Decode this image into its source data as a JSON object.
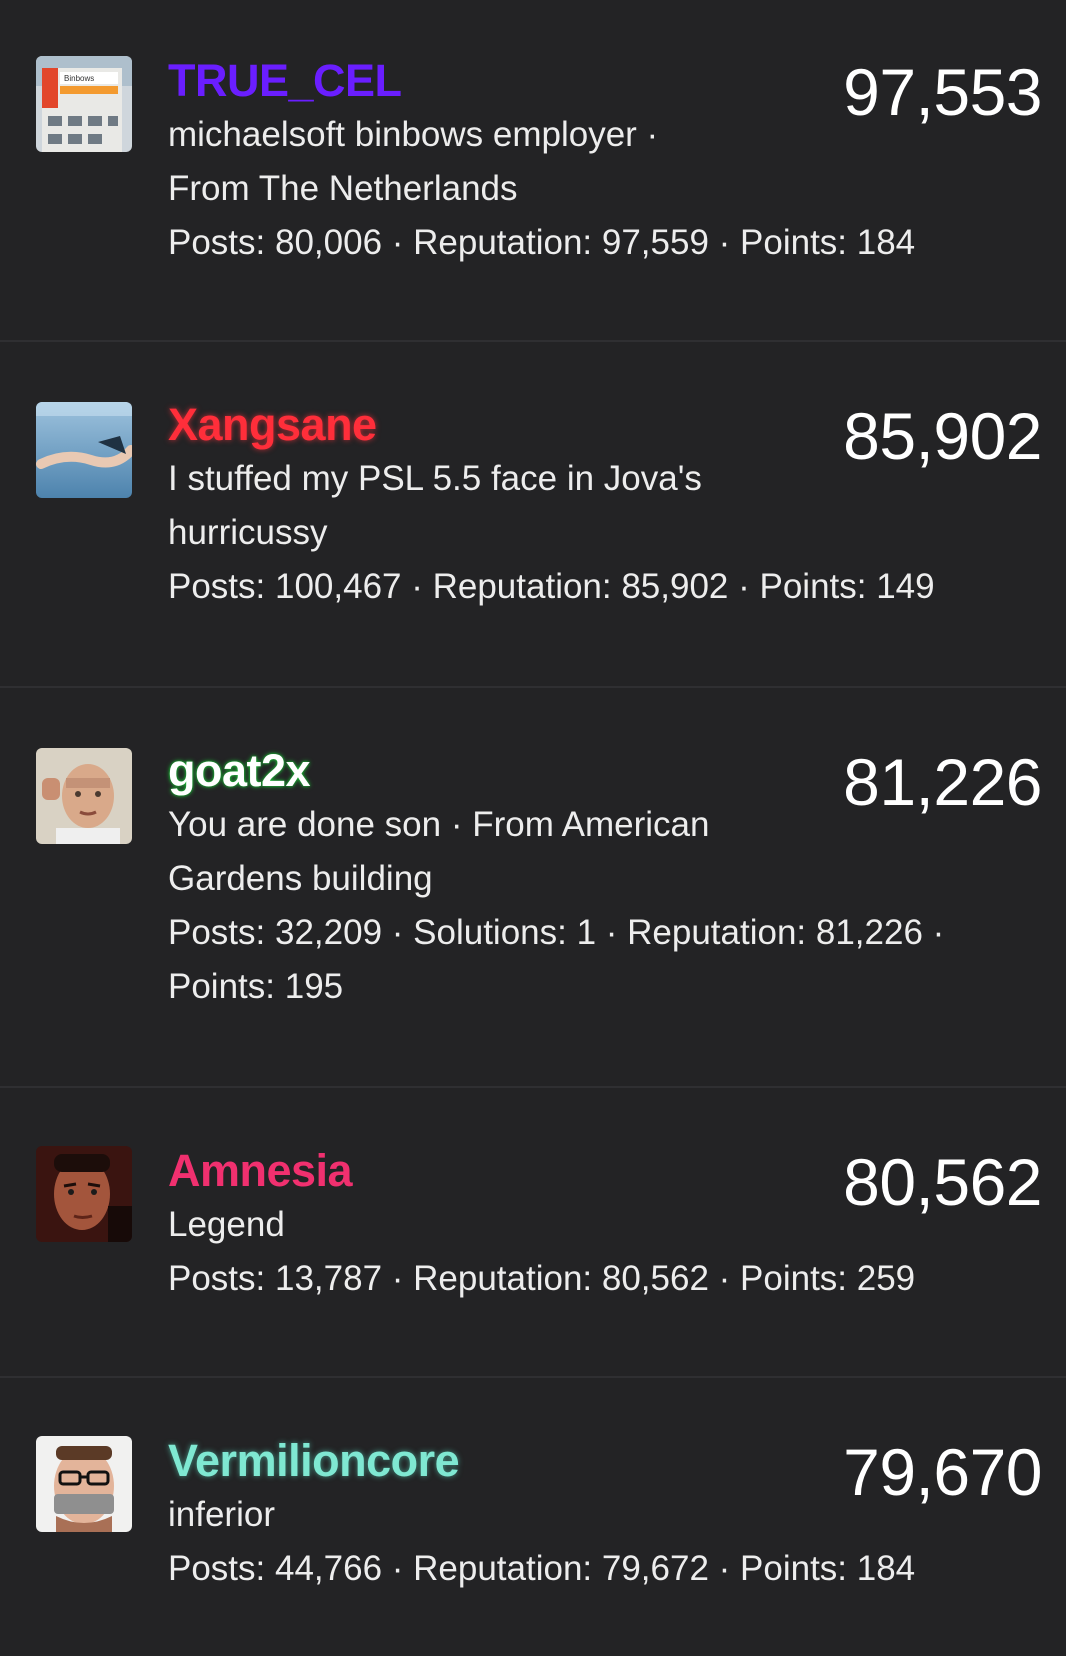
{
  "users": [
    {
      "username": "TRUE_CEL",
      "name_color": "#6a1eff",
      "avatar_icon": "building-photo-avatar",
      "lines": [
        "michaelsoft binbows employer ·",
        "From The Netherlands",
        "Posts: 80,006 · Reputation: 97,559 · Points: 184"
      ],
      "score": "97,553"
    },
    {
      "username": "Xangsane",
      "name_color": "#ff2e3a",
      "avatar_icon": "underwater-photo-avatar",
      "lines": [
        "I stuffed my PSL 5.5 face in Jova's",
        "hurricussy",
        "Posts: 100,467 · Reputation: 85,902 · Points: 149"
      ],
      "score": "85,902"
    },
    {
      "username": "goat2x",
      "name_color": "#ffffff",
      "avatar_icon": "man-photo-avatar",
      "lines": [
        "You are done son · From American",
        "Gardens building",
        "Posts: 32,209 · Solutions: 1 · Reputation: 81,226 ·",
        "Points: 195"
      ],
      "score": "81,226"
    },
    {
      "username": "Amnesia",
      "name_color": "#f0306f",
      "avatar_icon": "man-portrait-avatar",
      "lines": [
        "Legend",
        "Posts: 13,787 · Reputation: 80,562 · Points: 259"
      ],
      "score": "80,562"
    },
    {
      "username": "Vermilioncore",
      "name_color": "#7fe8d2",
      "avatar_icon": "taped-mouth-man-avatar",
      "lines": [
        "inferior",
        "Posts: 44,766 · Reputation: 79,672 · Points: 184"
      ],
      "score": "79,670"
    }
  ]
}
